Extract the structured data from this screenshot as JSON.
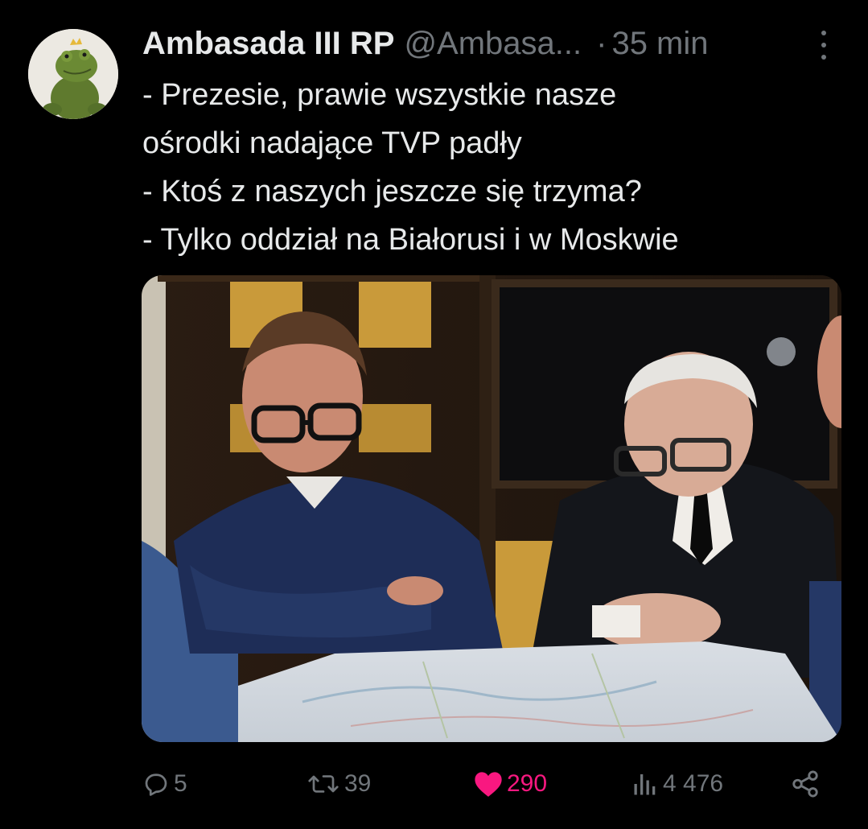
{
  "author": {
    "display_name": "Ambasada III RP",
    "handle": "@Ambasa...",
    "separator": "·",
    "time": "35 min"
  },
  "tweet": {
    "lines": [
      "- Prezesie, prawie wszystkie nasze",
      "ośrodki nadające TVP padły",
      "- Ktoś z naszych jeszcze się trzyma?",
      "- Tylko oddział na Białorusi i w Moskwie"
    ]
  },
  "metrics": {
    "replies": "5",
    "retweets": "39",
    "likes": "290",
    "views": "4 476"
  },
  "icons": {
    "more": "more-dots-icon",
    "reply": "reply-bubble-icon",
    "retweet": "retweet-icon",
    "like": "heart-icon",
    "views": "bar-chart-icon",
    "share": "share-icon"
  },
  "colors": {
    "background": "#000000",
    "text": "#e7e9ea",
    "muted": "#71767b",
    "like_active": "#f91880"
  }
}
